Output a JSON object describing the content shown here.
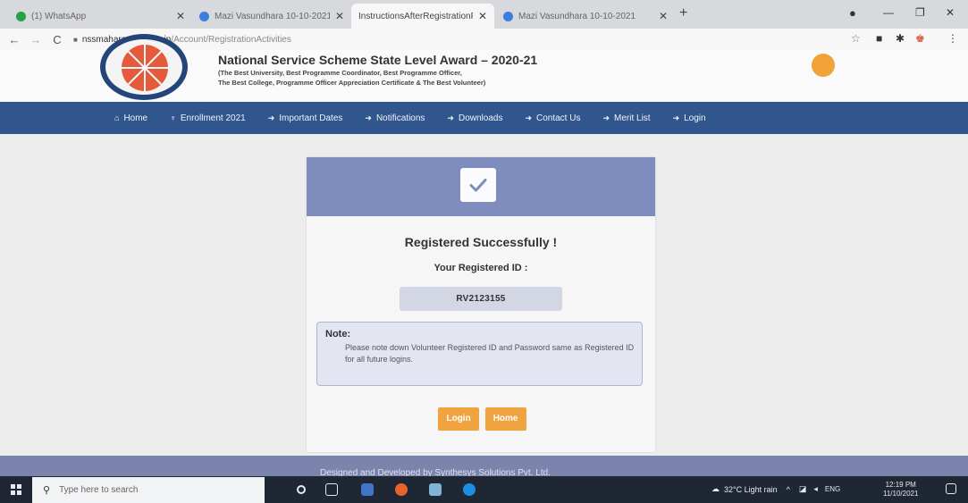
{
  "browser": {
    "tabs": [
      {
        "title": "(1) WhatsApp",
        "icon": "whatsapp-icon"
      },
      {
        "title": "Mazi Vasundhara 10-10-2021",
        "icon": "drive-icon"
      },
      {
        "title": "InstructionsAfterRegistrationPV",
        "icon": "page-icon"
      },
      {
        "title": "Mazi Vasundhara 10-10-2021",
        "icon": "drive-icon"
      }
    ],
    "url_domain": "nssmaharashtra.org.in",
    "url_path": "/Account/RegistrationActivities"
  },
  "header": {
    "title": "National Service Scheme State Level Award – 2020-21",
    "subtitle1": "(The Best University, Best Programme Coordinator, Best Programme Officer,",
    "subtitle2": "The Best College, Programme Officer Appreciation Certificate & The Best Volunteer)"
  },
  "nav": {
    "items": [
      {
        "label": "Home",
        "icon": "home-icon"
      },
      {
        "label": "Enrollment 2021",
        "icon": "trophy-icon"
      },
      {
        "label": "Important Dates",
        "icon": "sign-in-icon"
      },
      {
        "label": "Notifications",
        "icon": "sign-in-icon"
      },
      {
        "label": "Downloads",
        "icon": "sign-in-icon"
      },
      {
        "label": "Contact Us",
        "icon": "sign-in-icon"
      },
      {
        "label": "Merit List",
        "icon": "sign-in-icon"
      },
      {
        "label": "Login",
        "icon": "sign-in-icon"
      }
    ]
  },
  "card": {
    "title": "Registered Successfully !",
    "id_label": "Your Registered ID :",
    "id_value": "RV2123155",
    "note_title": "Note:",
    "note_text": "Please note down Volunteer Registered ID and Password same as Registered ID for all future logins.",
    "login_button": "Login",
    "home_button": "Home",
    "accent_color": "#7e8dbd",
    "button_color": "#f0a33f"
  },
  "footer": {
    "text": "Designed and Developed by Synthesys Solutions Pvt. Ltd."
  },
  "taskbar": {
    "search_placeholder": "Type here to search",
    "weather": "32°C  Light rain",
    "language": "ENG",
    "time": "12:19 PM",
    "date": "11/10/2021"
  }
}
